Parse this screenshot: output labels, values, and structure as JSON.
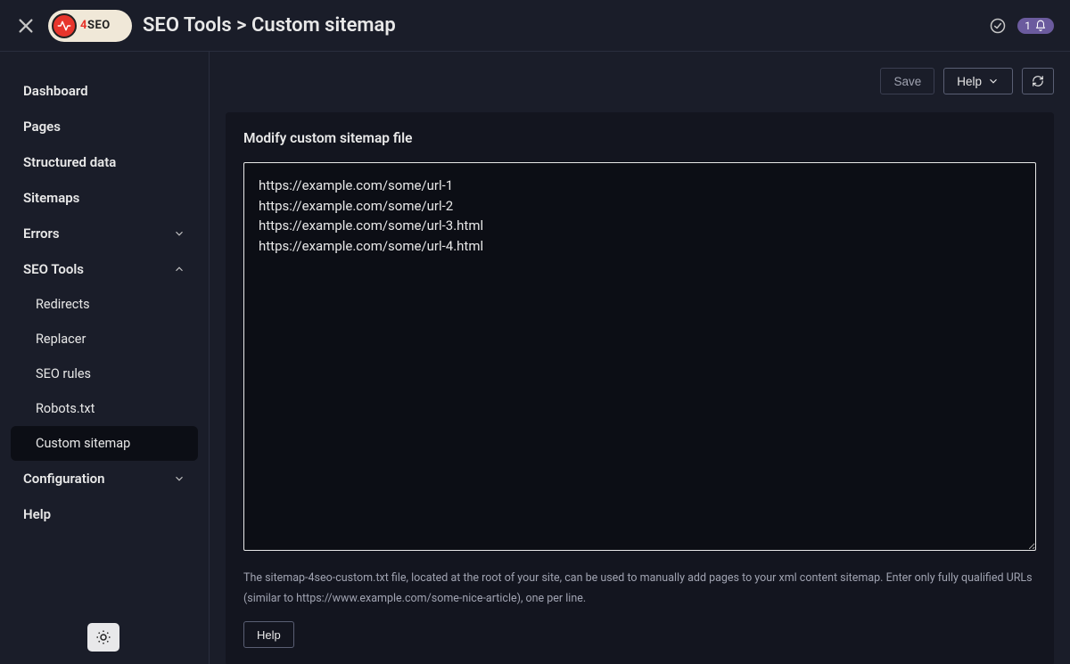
{
  "header": {
    "logo_text": "4SEO",
    "breadcrumb": "SEO Tools > Custom sitemap",
    "notif_count": "1"
  },
  "sidebar": {
    "items": [
      {
        "label": "Dashboard"
      },
      {
        "label": "Pages"
      },
      {
        "label": "Structured data"
      },
      {
        "label": "Sitemaps"
      },
      {
        "label": "Errors",
        "expandable": true,
        "expanded": false
      },
      {
        "label": "SEO Tools",
        "expandable": true,
        "expanded": true,
        "children": [
          {
            "label": "Redirects"
          },
          {
            "label": "Replacer"
          },
          {
            "label": "SEO rules"
          },
          {
            "label": "Robots.txt"
          },
          {
            "label": "Custom sitemap",
            "active": true
          }
        ]
      },
      {
        "label": "Configuration",
        "expandable": true,
        "expanded": false
      },
      {
        "label": "Help"
      }
    ]
  },
  "toolbar": {
    "save_label": "Save",
    "help_label": "Help"
  },
  "panel": {
    "title": "Modify custom sitemap file",
    "textarea_value": "https://example.com/some/url-1\nhttps://example.com/some/url-2\nhttps://example.com/some/url-3.html\nhttps://example.com/some/url-4.html\n",
    "hint": "The sitemap-4seo-custom.txt file, located at the root of your site, can be used to manually add pages to your xml content sitemap. Enter only fully qualified URLs (similar to https://www.example.com/some-nice-article), one per line.",
    "help_label": "Help"
  }
}
